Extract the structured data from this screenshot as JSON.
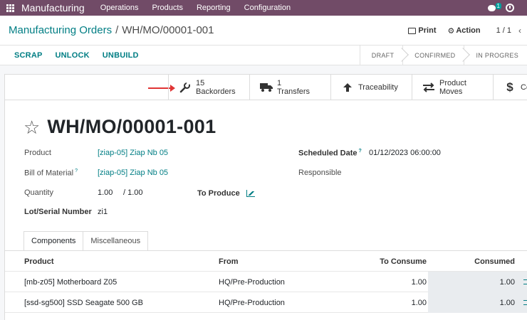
{
  "navbar": {
    "brand": "Manufacturing",
    "menus": [
      "Operations",
      "Products",
      "Reporting",
      "Configuration"
    ],
    "chat_badge": "1",
    "accent_color": "#714b67"
  },
  "breadcrumb": {
    "parent": "Manufacturing Orders",
    "separator": "/",
    "current": "WH/MO/00001-001"
  },
  "actions": {
    "print": "Print",
    "action": "Action",
    "pager": "1 / 1",
    "prev": "‹"
  },
  "controls": {
    "buttons": [
      "SCRAP",
      "UNLOCK",
      "UNBUILD"
    ],
    "statuses": [
      "DRAFT",
      "CONFIRMED",
      "IN PROGRES"
    ]
  },
  "smart_buttons": {
    "backorders": {
      "count": "15",
      "label": "Backorders",
      "icon": "wrench-icon"
    },
    "transfers": {
      "count": "1",
      "label": "Transfers",
      "icon": "truck-icon"
    },
    "traceability": {
      "label": "Traceability",
      "icon": "arrow-up-icon"
    },
    "product_moves": {
      "label_line1": "Product",
      "label_line2": "Moves",
      "icon": "exchange-icon"
    },
    "cost": {
      "label": "Co",
      "icon": "dollar-icon"
    }
  },
  "form": {
    "title": "WH/MO/00001-001",
    "product_label": "Product",
    "product_value": "[ziap-05] Ziap Nb 05",
    "bom_label": "Bill of Material",
    "bom_help": "?",
    "bom_value": "[ziap-05] Ziap Nb 05",
    "quantity_label": "Quantity",
    "quantity_value": "1.00",
    "quantity_total": "/ 1.00",
    "to_produce_label": "To Produce",
    "lot_label": "Lot/Serial Number",
    "lot_value": "zi1",
    "scheduled_label": "Scheduled Date",
    "scheduled_help": "?",
    "scheduled_value": "01/12/2023 06:00:00",
    "responsible_label": "Responsible"
  },
  "tabs": [
    "Components",
    "Miscellaneous"
  ],
  "table": {
    "headers": [
      "Product",
      "From",
      "To Consume",
      "Consumed"
    ],
    "rows": [
      {
        "product": "[mb-z05] Motherboard Z05",
        "from": "HQ/Pre-Production",
        "to_consume": "1.00",
        "consumed": "1.00"
      },
      {
        "product": "[ssd-sg500] SSD Seagate 500 GB",
        "from": "HQ/Pre-Production",
        "to_consume": "1.00",
        "consumed": "1.00"
      }
    ]
  }
}
